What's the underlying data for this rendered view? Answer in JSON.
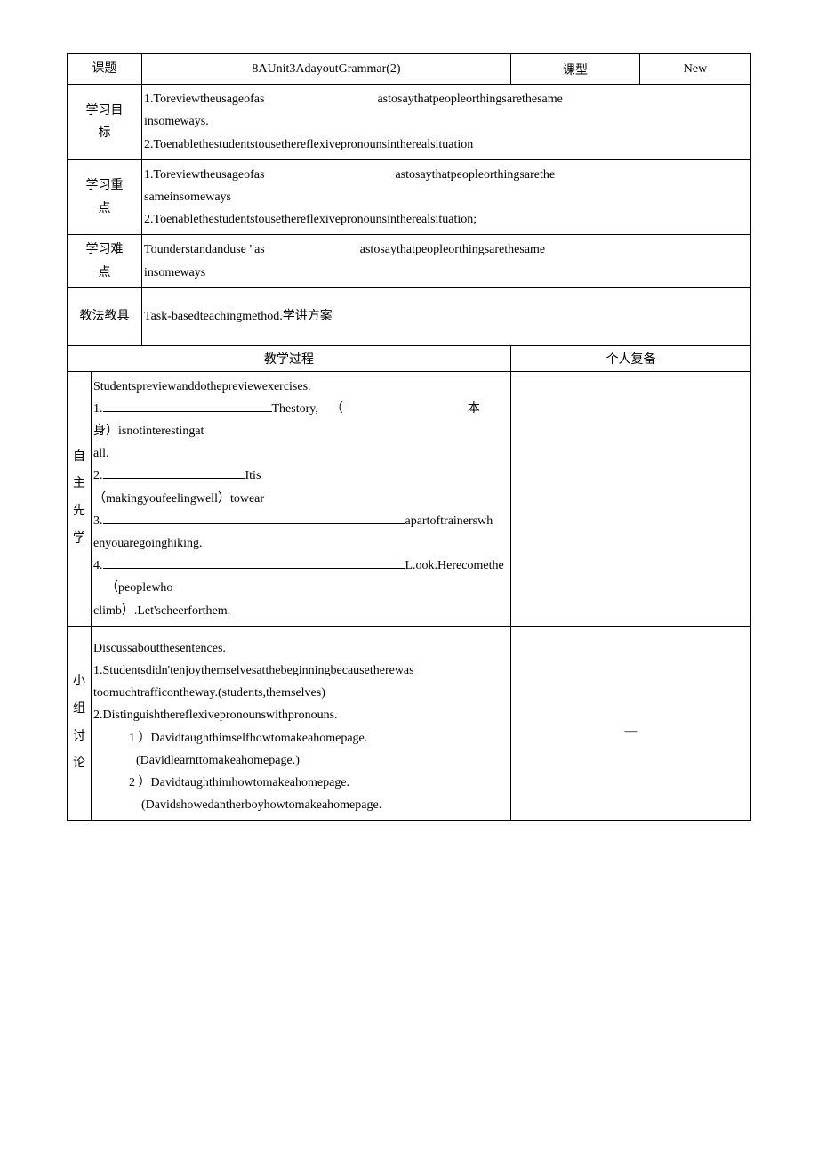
{
  "header": {
    "topic_label": "课题",
    "topic_value": "8AUnit3AdayoutGrammar(2)",
    "type_label": "课型",
    "type_value": "New"
  },
  "rows": {
    "objective_label_l1": "学习目",
    "objective_label_l2": "标",
    "objective_content_l1": "1.Toreviewtheusageofas",
    "objective_content_l1b": "astosaythatpeopleorthingsarethesame",
    "objective_content_l2": "insomeways.",
    "objective_content_l3": "2.Toenablethestudentstousethereflexivepronounsintherealsituation",
    "focus_label_l1": "学习重",
    "focus_label_l2": "点",
    "focus_content_l1": "1.Toreviewtheusageofas",
    "focus_content_l1b": "astosaythatpeopleorthingsarethe",
    "focus_content_l2": "sameinsomeways",
    "focus_content_l3": "2.Toenablethestudentstousethereflexivepronounsintherealsituation;",
    "difficulty_label_l1": "学习难",
    "difficulty_label_l2": "点",
    "difficulty_content_l1a": "Tounderstandanduse \"as",
    "difficulty_content_l1b": "astosaythatpeopleorthingsarethesame",
    "difficulty_content_l2": "insomeways",
    "method_label": "教法教具",
    "method_content": "Task-basedteachingmethod.学讲方案"
  },
  "process": {
    "process_label": "教学过程",
    "notes_label": "个人复备"
  },
  "sec1": {
    "label": [
      "自",
      "主",
      "先",
      "学"
    ],
    "l1": "Studentspreviewanddothepreviewexercises.",
    "l2a": "1.",
    "l2b": "Thestory,",
    "l2c": "（",
    "l2d": "本",
    "l3": "身）isnotinterestingat",
    "l4": "all.",
    "l5a": "2.",
    "l5b": "Itis",
    "l6": "（makingyoufeelingwell）towear",
    "l7a": "3.",
    "l7b": "apartoftrainerswh",
    "l8": "enyouaregoinghiking.",
    "l9a": "4.",
    "l9b": "L.ook.Herecomethe",
    "l10": "（peoplewho",
    "l11": "climb）.Let'scheerforthem."
  },
  "sec2": {
    "label": [
      "小",
      "组",
      "讨",
      "论"
    ],
    "l1": "Discussaboutthesentences.",
    "l2": "1.Studentsdidn'tenjoythemselvesatthebeginningbecausetherewas",
    "l3": "toomuchtrafficontheway.(students,themselves)",
    "l4": "2.Distinguishthereflexivepronounswithpronouns.",
    "l5": "1 ）Davidtaughthimselfhowtomakeahomepage.",
    "l6": "(Davidlearnttomakeahomepage.)",
    "l7": "2 ）Davidtaughthimhowtomakeahomepage.",
    "l8": "(Davidshowedantherboyhowtomakeahomepage.",
    "note": "—"
  }
}
